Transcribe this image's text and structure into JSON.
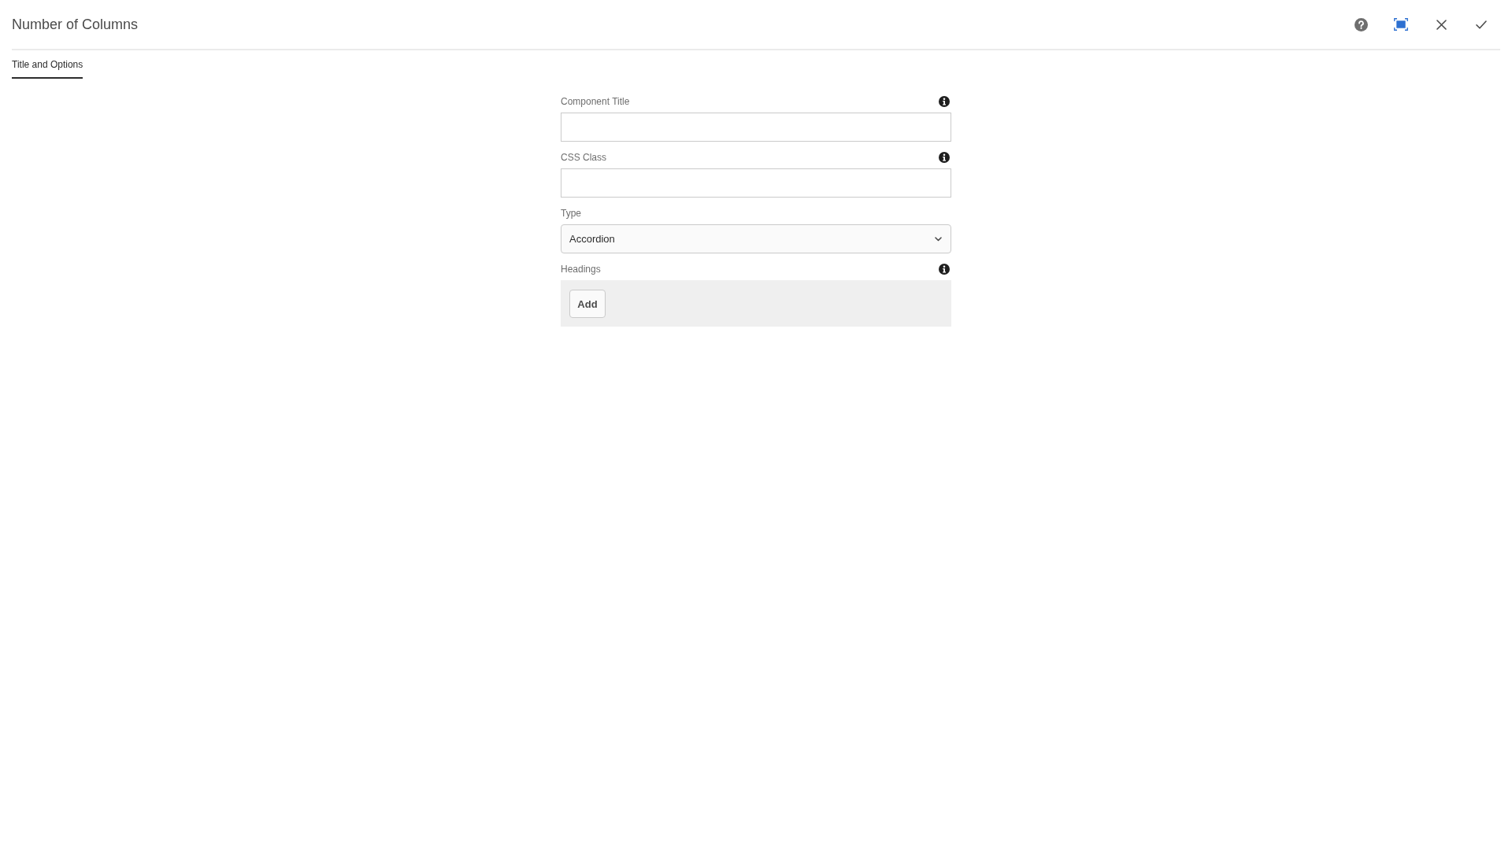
{
  "dialog": {
    "title": "Number of Columns"
  },
  "tabs": [
    {
      "label": "Title and Options",
      "selected": true
    }
  ],
  "fields": [
    {
      "kind": "text",
      "label": "Component Title",
      "info": true
    },
    {
      "kind": "text",
      "label": "CSS Class",
      "info": true
    },
    {
      "kind": "select",
      "label": "Type",
      "info": false,
      "value": "Accordion"
    },
    {
      "kind": "multifield",
      "label": "Headings",
      "info": true,
      "add_button": "Add"
    }
  ]
}
